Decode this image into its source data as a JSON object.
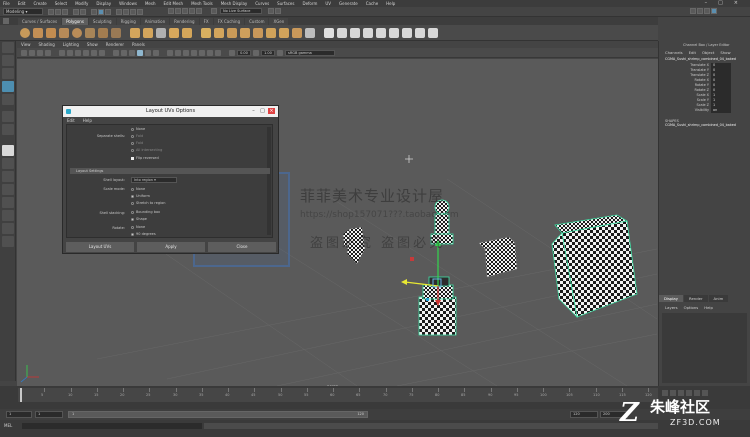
{
  "menubar": {
    "items": [
      "File",
      "Edit",
      "Create",
      "Select",
      "Modify",
      "Display",
      "Windows",
      "Mesh",
      "Edit Mesh",
      "Mesh Tools",
      "Mesh Display",
      "Curves",
      "Surfaces",
      "Deform",
      "UV",
      "Generate",
      "Cache",
      "Help"
    ]
  },
  "status": {
    "mode": "Modeling",
    "live_surface": "No Live Surface"
  },
  "shelf": {
    "tabs": [
      "Curves / Surfaces",
      "Polygons",
      "Sculpting",
      "Rigging",
      "Animation",
      "Rendering",
      "FX",
      "FX Caching",
      "Custom",
      "XGen"
    ],
    "active_tab": "Polygons"
  },
  "viewport": {
    "menu": [
      "View",
      "Shading",
      "Lighting",
      "Show",
      "Renderer",
      "Panels"
    ],
    "field_a": "0.00",
    "field_b": "1.00",
    "color_space": "sRGB gamma",
    "camera_label": "persp"
  },
  "dialog": {
    "title": "Layout UVs Options",
    "menu": [
      "Edit",
      "Help"
    ],
    "top_options": {
      "separate_label": "Separate shells:",
      "opt_none": "None",
      "opt_fold": "Fold",
      "opt_fold2": "Fold",
      "opt_all": "All intersecting",
      "flip_reversed": "Flip reversed"
    },
    "section": "Layout Settings",
    "shell_layout_label": "Shell layout:",
    "shell_layout_value": "Into region",
    "scale_mode_label": "Scale mode:",
    "scale_none": "None",
    "scale_uniform": "Uniform",
    "scale_stretch": "Stretch to region",
    "shell_stacking_label": "Shell stacking:",
    "stack_bbox": "Bounding box",
    "stack_shape": "Shape",
    "rotate_label": "Rotate:",
    "rotate_none": "None",
    "rotate_90": "90 degrees",
    "buttons": {
      "layout": "Layout UVs",
      "apply": "Apply",
      "close": "Close"
    }
  },
  "channel_box": {
    "title": "Channel Box / Layer Editor",
    "menu": [
      "Channels",
      "Edit",
      "Object",
      "Show"
    ],
    "object": "CGMA_Sushi_shrimp_combined_04_baked",
    "attrs": [
      {
        "name": "Translate X",
        "value": "0"
      },
      {
        "name": "Translate Y",
        "value": "0"
      },
      {
        "name": "Translate Z",
        "value": "0"
      },
      {
        "name": "Rotate X",
        "value": "0"
      },
      {
        "name": "Rotate Y",
        "value": "0"
      },
      {
        "name": "Rotate Z",
        "value": "0"
      },
      {
        "name": "Scale X",
        "value": "1"
      },
      {
        "name": "Scale Y",
        "value": "1"
      },
      {
        "name": "Scale Z",
        "value": "1"
      },
      {
        "name": "Visibility",
        "value": "on"
      }
    ],
    "shapes_label": "SHAPES",
    "shape_name": "CGMA_Sushi_shrimp_combined_04_baked"
  },
  "layer_editor": {
    "tabs": [
      "Display",
      "Render",
      "Anim"
    ],
    "menu": [
      "Layers",
      "Options",
      "Help"
    ]
  },
  "timeline": {
    "tick_labels": [
      "5",
      "10",
      "15",
      "20",
      "25",
      "30",
      "35",
      "40",
      "45",
      "50",
      "55",
      "60",
      "65",
      "70",
      "75",
      "80",
      "85",
      "90",
      "95",
      "100",
      "105",
      "110",
      "115",
      "120"
    ],
    "start": "1",
    "start_inner": "1",
    "range_start_label": "1",
    "range_end_label": "120",
    "end_inner": "120",
    "end": "200"
  },
  "cmdline": {
    "label": "MEL"
  },
  "watermark": {
    "cn_large": "菲菲美术专业设计屋",
    "url": "https://shop157071???.taobao.com",
    "cn_small": "盗图必究  盗图必究",
    "seal_1": "菲菲",
    "seal_2": "设计",
    "brand_cn": "朱峰社区",
    "brand_en": "ZF3D.COM"
  }
}
